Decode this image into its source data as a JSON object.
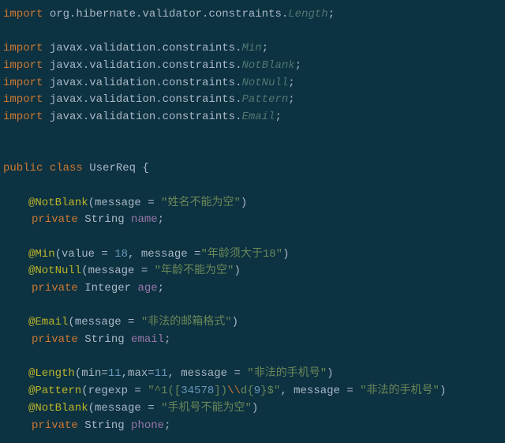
{
  "imports": {
    "kw": "import",
    "p1": "org.hibernate.validator.constraints.",
    "c1": "Length",
    "p2": "javax.validation.constraints.",
    "cMin": "Min",
    "cNotBlank": "NotBlank",
    "cNotNull": "NotNull",
    "cPattern": "Pattern",
    "cEmail": "Email"
  },
  "decl": {
    "public": "public",
    "class": "class",
    "name": "UserReq",
    "open": " {"
  },
  "f1": {
    "ann": "@NotBlank",
    "argL": "(message = ",
    "msg": "\"姓名不能为空\"",
    "argR": ")",
    "priv": "private",
    "type": "String",
    "name": "name",
    "semi": ";"
  },
  "f2": {
    "annMin": "@Min",
    "minL": "(value = ",
    "minV": "18",
    "minM": ", message =",
    "minMsg": "\"年龄须大于18\"",
    "minR": ")",
    "annNN": "@NotNull",
    "nnL": "(message = ",
    "nnMsg": "\"年龄不能为空\"",
    "nnR": ")",
    "priv": "private",
    "type": "Integer",
    "name": "age",
    "semi": ";"
  },
  "f3": {
    "ann": "@Email",
    "argL": "(message = ",
    "msg": "\"非法的邮箱格式\"",
    "argR": ")",
    "priv": "private",
    "type": "String",
    "name": "email",
    "semi": ";"
  },
  "f4": {
    "annLen": "@Length",
    "lenL": "(min=",
    "lenMin": "11",
    "lenMid": ",max=",
    "lenMax": "11",
    "lenM": ", message = ",
    "lenMsg": "\"非法的手机号\"",
    "lenR": ")",
    "annPat": "@Pattern",
    "patL": "(regexp = ",
    "reg1": "\"^1([",
    "regD": "34578",
    "reg2": "])",
    "regBs": "\\\\",
    "reg3": "d{",
    "regN": "9",
    "reg4": "}$\"",
    "patM": ", message = ",
    "patMsg": "\"非法的手机号\"",
    "patR": ")",
    "annNB": "@NotBlank",
    "nbL": "(message = ",
    "nbMsg": "\"手机号不能为空\"",
    "nbR": ")",
    "priv": "private",
    "type": "String",
    "name": "phone",
    "semi": ";"
  }
}
